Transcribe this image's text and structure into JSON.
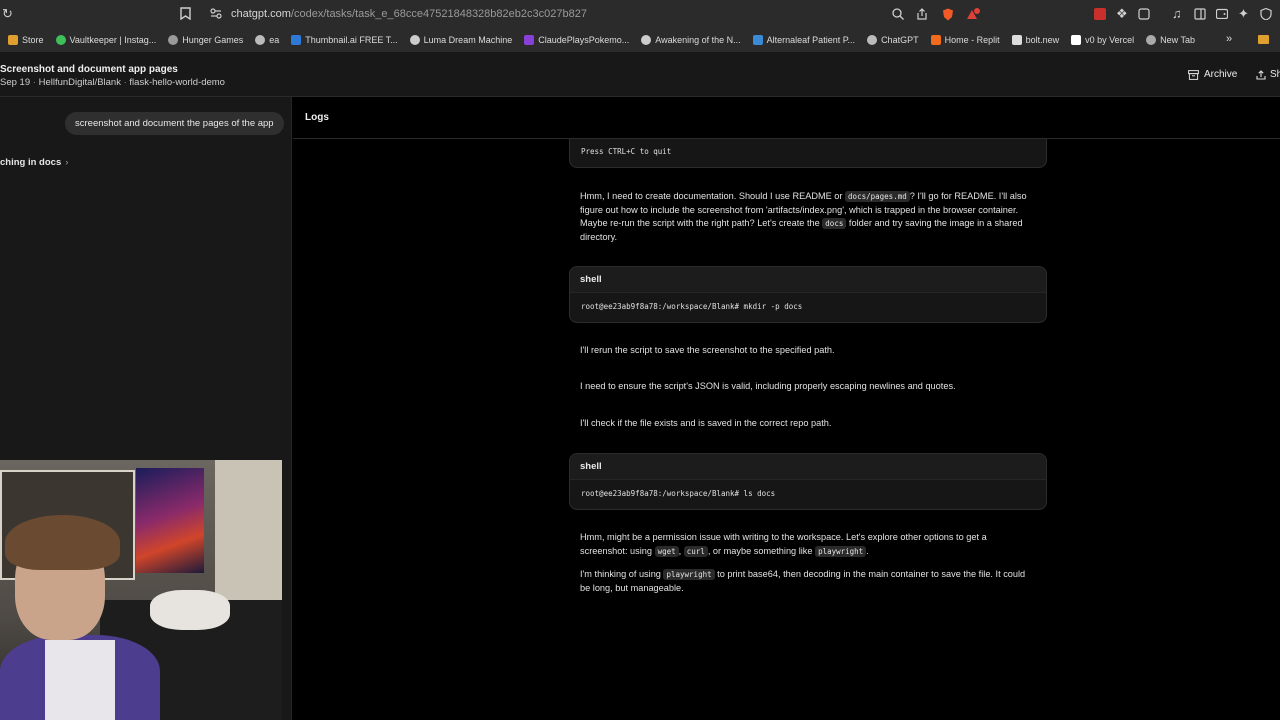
{
  "browser": {
    "url_host": "chatgpt.com",
    "url_path": "/codex/tasks/task_e_68cce47521848328b82eb2c3c027b827",
    "bookmarks": [
      {
        "label": "Store",
        "color": "#e0a030"
      },
      {
        "label": "Vaultkeeper | Instag...",
        "color": "#3fbf5a"
      },
      {
        "label": "Hunger Games",
        "color": "#9a9a9a"
      },
      {
        "label": "ea",
        "color": "#bbbbbb"
      },
      {
        "label": "Thumbnail.ai FREE T...",
        "color": "#2e7ad6"
      },
      {
        "label": "Luma Dream Machine",
        "color": "#cccccc"
      },
      {
        "label": "ClaudePlaysPokemo...",
        "color": "#8a3fd6"
      },
      {
        "label": "Awakening of the N...",
        "color": "#cccccc"
      },
      {
        "label": "Alternaleaf Patient P...",
        "color": "#3a8ad6"
      },
      {
        "label": "ChatGPT",
        "color": "#bbbbbb"
      },
      {
        "label": "Home - Replit",
        "color": "#f26b1d"
      },
      {
        "label": "bolt.new",
        "color": "#dddddd"
      },
      {
        "label": "v0 by Vercel",
        "color": "#ffffff"
      },
      {
        "label": "New Tab",
        "color": "#aaaaaa"
      }
    ],
    "more_bookmarks_label": "»"
  },
  "header": {
    "title": "Screenshot and document app pages",
    "date": "Sep 19",
    "repo": "HellfunDigital/Blank",
    "branch": "flask-hello-world-demo",
    "archive_label": "Archive",
    "share_label": "Sh"
  },
  "sidebar": {
    "user_message": "screenshot and document the pages of the app",
    "status_text": "ching in docs",
    "status_chevron": "›"
  },
  "logs": {
    "tab_label": "Logs",
    "partial_card_text": "Press CTRL+C to quit",
    "paragraph1": {
      "t1": "Hmm, I need to create documentation. Should I use README or ",
      "c1": "docs/pages.md",
      "t2": "? I'll go for README. I'll also figure out how to include the screenshot from 'artifacts/index.png', which is trapped in the browser container. Maybe re-run the script with the right path? Let's create the ",
      "c2": "docs",
      "t3": " folder and try saving the image in a shared directory."
    },
    "card1": {
      "label": "shell",
      "command": "root@ee23ab9f8a78:/workspace/Blank# mkdir -p docs"
    },
    "paragraph2": "I'll rerun the script to save the screenshot to the specified path.",
    "paragraph3": "I need to ensure the script's JSON is valid, including properly escaping newlines and quotes.",
    "paragraph4": "I'll check if the file exists and is saved in the correct repo path.",
    "card2": {
      "label": "shell",
      "command": "root@ee23ab9f8a78:/workspace/Blank# ls docs"
    },
    "paragraph5": {
      "t1": "Hmm, might be a permission issue with writing to the workspace. Let's explore other options to get a screenshot: using ",
      "c1": "wget",
      "t2": ", ",
      "c2": "curl",
      "t3": ", or maybe something like ",
      "c3": "playwright",
      "t4": "."
    },
    "paragraph6": {
      "t1": "I'm thinking of using ",
      "c1": "playwright",
      "t2": " to print base64, then decoding in the main container to save the file. It could be long, but manageable."
    }
  }
}
